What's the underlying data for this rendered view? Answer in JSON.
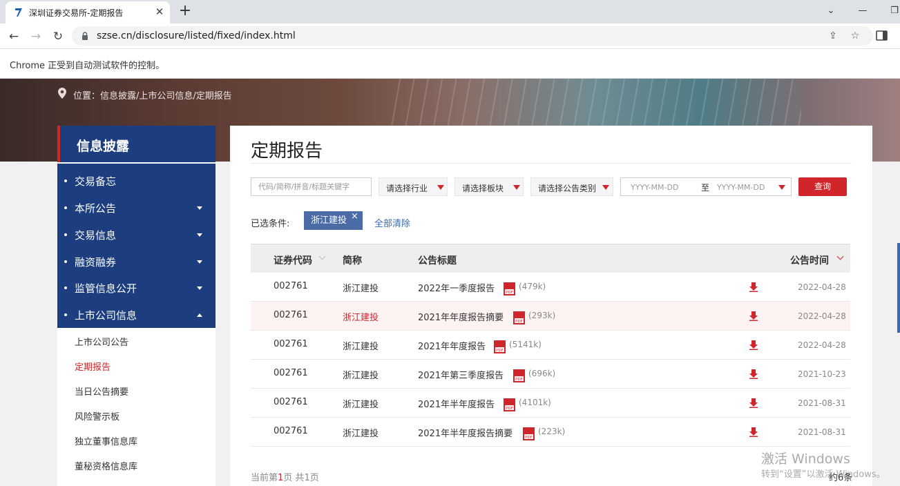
{
  "browser": {
    "tab_title": "深圳证券交易所-定期报告",
    "url": "szse.cn/disclosure/listed/fixed/index.html",
    "infobar_text": "Chrome 正受到自动测试软件的控制。"
  },
  "breadcrumb": {
    "text": "位置：信息披露/上市公司信息/定期报告"
  },
  "sidebar": {
    "title": "信息披露",
    "items": [
      {
        "label": "交易备忘",
        "caret": "none"
      },
      {
        "label": "本所公告",
        "caret": "down"
      },
      {
        "label": "交易信息",
        "caret": "down"
      },
      {
        "label": "融资融券",
        "caret": "down"
      },
      {
        "label": "监管信息公开",
        "caret": "down"
      },
      {
        "label": "上市公司信息",
        "caret": "up"
      }
    ],
    "subitems": [
      {
        "label": "上市公司公告",
        "active": false
      },
      {
        "label": "定期报告",
        "active": true
      },
      {
        "label": "当日公告摘要",
        "active": false
      },
      {
        "label": "风险警示板",
        "active": false
      },
      {
        "label": "独立董事信息库",
        "active": false
      },
      {
        "label": "董秘资格信息库",
        "active": false
      }
    ]
  },
  "main": {
    "title": "定期报告",
    "search_placeholder": "代码/简称/拼音/标题关键字",
    "filters": {
      "industry": "请选择行业",
      "board": "请选择板块",
      "category": "请选择公告类别"
    },
    "date_start_placeholder": "YYYY-MM-DD",
    "date_sep": "至",
    "date_end_placeholder": "YYYY-MM-DD",
    "query_label": "查询",
    "selected_label": "已选条件:",
    "selected_tag": "浙江建投",
    "clear_all": "全部清除"
  },
  "table": {
    "headers": {
      "code": "证券代码",
      "name": "简称",
      "title": "公告标题",
      "time": "公告时间"
    },
    "rows": [
      {
        "code": "002761",
        "name": "浙江建投",
        "title": "2022年一季度报告",
        "size": "(479k)",
        "date": "2022-04-28"
      },
      {
        "code": "002761",
        "name": "浙江建投",
        "title": "2021年年度报告摘要",
        "size": "(293k)",
        "date": "2022-04-28"
      },
      {
        "code": "002761",
        "name": "浙江建投",
        "title": "2021年年度报告",
        "size": "(5141k)",
        "date": "2022-04-28"
      },
      {
        "code": "002761",
        "name": "浙江建投",
        "title": "2021年第三季度报告",
        "size": "(696k)",
        "date": "2021-10-23"
      },
      {
        "code": "002761",
        "name": "浙江建投",
        "title": "2021年半年度报告",
        "size": "(4101k)",
        "date": "2021-08-31"
      },
      {
        "code": "002761",
        "name": "浙江建投",
        "title": "2021年半年度报告摘要",
        "size": "(223k)",
        "date": "2021-08-31"
      }
    ]
  },
  "pager": {
    "prefix": "当前第",
    "current": "1",
    "middle": "页  共",
    "total_pages": "1",
    "suffix": "页",
    "total": "约6条"
  },
  "watermark": {
    "line1": "激活 Windows",
    "line2": "转到“设置”以激活 Windows。"
  },
  "colors": {
    "accent_red": "#d0252b",
    "nav_blue": "#1c3d7e",
    "tag_blue": "#4a6ba5",
    "link_blue": "#3a6ab3"
  }
}
